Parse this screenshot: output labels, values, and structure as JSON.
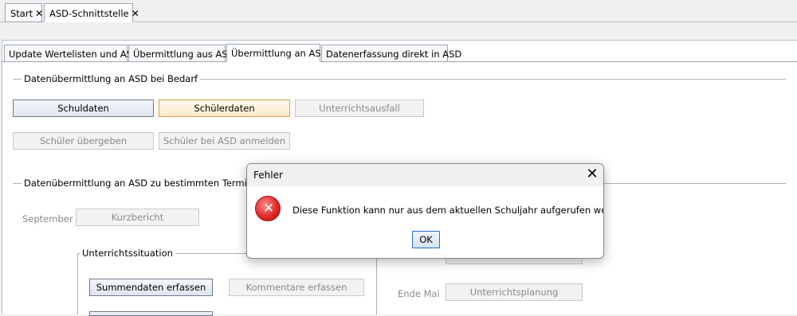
{
  "top_tabs": [
    {
      "label": "Start"
    },
    {
      "label": "ASD-Schnittstelle"
    }
  ],
  "sub_tabs": [
    {
      "label": "Update Wertelisten und ASV"
    },
    {
      "label": "Übermittlung aus ASD"
    },
    {
      "label": "Übermittlung an ASD"
    },
    {
      "label": "Datenerfassung direkt in ASD"
    }
  ],
  "section_bedarf": {
    "title": "Datenübermittlung an ASD bei Bedarf",
    "schuldaten": "Schuldaten",
    "schuelerdaten": "Schülerdaten",
    "unterrichtsausfall": "Unterrichtsausfall",
    "schueler_uebergeben": "Schüler übergeben",
    "schueler_anmelden": "Schüler bei ASD anmelden"
  },
  "section_termine": {
    "title": "Datenübermittlung an ASD zu bestimmten Terminen",
    "september_label": "September",
    "kurzbericht": "Kurzbericht",
    "unterrichtssituation_title": "Unterrichtssituation",
    "summendaten": "Summendaten erfassen",
    "kommentare": "Kommentare erfassen",
    "ende_mai_label": "Ende Mai",
    "unterrichtsplanung": "Unterrichtsplanung"
  },
  "dialog": {
    "title": "Fehler",
    "close_glyph": "✕",
    "error_glyph": "✕",
    "message": "Diese Funktion kann nur aus dem aktuellen Schuljahr aufgerufen werden!",
    "ok_label": "OK"
  }
}
